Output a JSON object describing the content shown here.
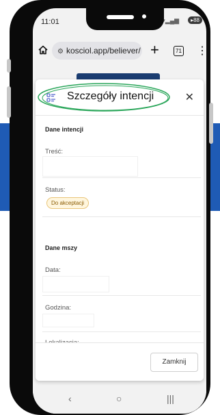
{
  "status_bar": {
    "time": "11:01",
    "battery": "88"
  },
  "browser": {
    "url": "kosciol.app/believer/",
    "tab_count": "71"
  },
  "modal": {
    "title": "Szczegóły intencji",
    "section_intention": "Dane intencji",
    "content_label": "Treść:",
    "status_label": "Status:",
    "status_value": "Do akceptacji",
    "section_mass": "Dane mszy",
    "date_label": "Data:",
    "time_label": "Godzina:",
    "location_label": "Lokalizacja:",
    "close_button": "Zamknij"
  },
  "colors": {
    "highlight_ellipse": "#2aa65a",
    "status_badge_bg": "#fff6de",
    "status_badge_border": "#e9c57a"
  },
  "icons": [
    "home-icon",
    "tune-icon",
    "plus-icon",
    "tabs-icon",
    "more-vert-icon",
    "list-details-icon",
    "close-icon",
    "back-icon",
    "home-nav-icon",
    "recents-icon"
  ]
}
